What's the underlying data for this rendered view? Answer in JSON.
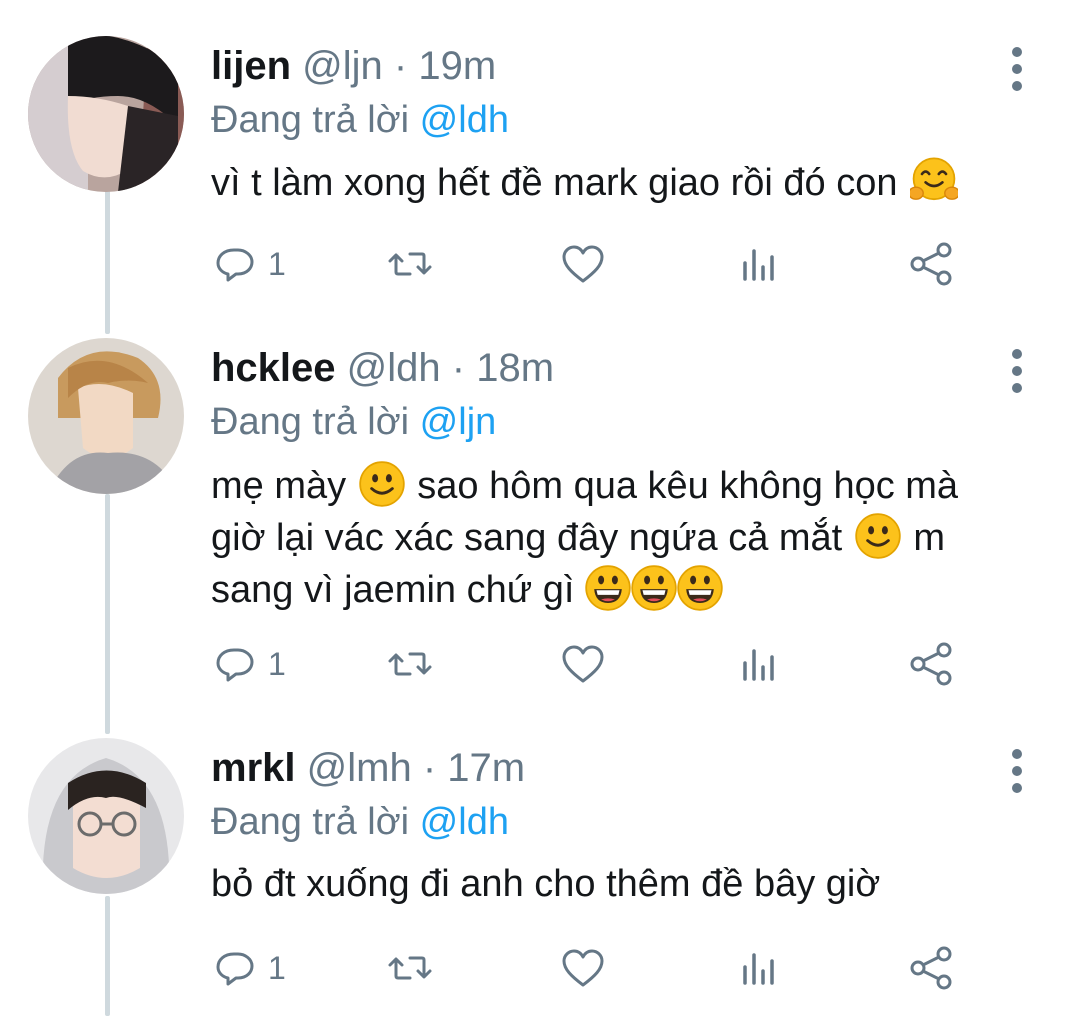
{
  "replies": [
    {
      "name": "lijen",
      "handle": "@ljn",
      "separator": "·",
      "time": "19m",
      "reply_prefix": "Đang trả lời",
      "reply_to": "@ldh",
      "text_parts": [
        "vì t làm xong hết đề mark giao rồi đó con"
      ],
      "emoji": [
        "hugging-face"
      ],
      "reply_count": "1"
    },
    {
      "name": "hcklee",
      "handle": "@ldh",
      "separator": "·",
      "time": "18m",
      "reply_prefix": "Đang trả lời",
      "reply_to": "@ljn",
      "text_parts": [
        "mẹ mày",
        "sao hôm qua kêu không học mà",
        "giờ lại vác xác sang đây ngứa cả mắt",
        "m",
        "sang vì jaemin chứ gì"
      ],
      "emoji": [
        "slightly-smiling-face",
        "slightly-smiling-face",
        "grinning-face",
        "grinning-face",
        "grinning-face"
      ],
      "reply_count": "1"
    },
    {
      "name": "mrkl",
      "handle": "@lmh",
      "separator": "·",
      "time": "17m",
      "reply_prefix": "Đang trả lời",
      "reply_to": "@ldh",
      "text_parts": [
        "bỏ đt xuống đi anh cho thêm đề bây giờ"
      ],
      "emoji": [],
      "reply_count": "1"
    }
  ],
  "icons": {
    "reply": "reply-icon",
    "retweet": "retweet-icon",
    "like": "heart-icon",
    "analytics": "analytics-icon",
    "share": "share-icon",
    "more": "more-vertical-icon"
  },
  "colors": {
    "name": "#14171a",
    "meta": "#657786",
    "mention": "#1da1f2",
    "thread_line": "#cfd9de"
  }
}
